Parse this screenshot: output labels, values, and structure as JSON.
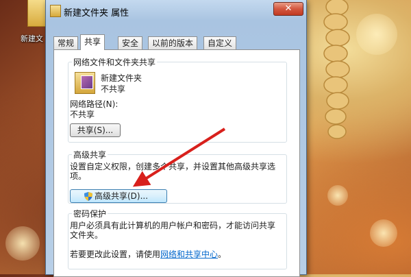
{
  "desktop": {
    "icon_label": "新建文",
    "accent_wallpaper": "#b86432"
  },
  "window": {
    "title": "新建文件夹 属性",
    "close_glyph": "✕"
  },
  "tabs": [
    {
      "label": "常规"
    },
    {
      "label": "共享"
    },
    {
      "label": "安全"
    },
    {
      "label": "以前的版本"
    },
    {
      "label": "自定义"
    }
  ],
  "active_tab": "共享",
  "sharing": {
    "title": "网络文件和文件夹共享",
    "folder_name": "新建文件夹",
    "folder_status": "不共享",
    "netpath_label": "网络路径(N):",
    "netpath_value": "不共享",
    "share_button": "共享(S)..."
  },
  "advanced": {
    "title": "高级共享",
    "description": "设置自定义权限，创建多个共享，并设置其他高级共享选项。",
    "button": "高级共享(D)..."
  },
  "password": {
    "title": "密码保护",
    "description": "用户必须具有此计算机的用户帐户和密码，才能访问共享文件夹。",
    "change_prefix": "若要更改此设置，请使用",
    "link": "网络和共享中心",
    "change_suffix": "。"
  },
  "colors": {
    "arrow": "#d8201c",
    "link": "#0066cc"
  },
  "icons": [
    "folder-icon",
    "close-icon",
    "uac-shield-icon",
    "red-arrow-annotation"
  ]
}
